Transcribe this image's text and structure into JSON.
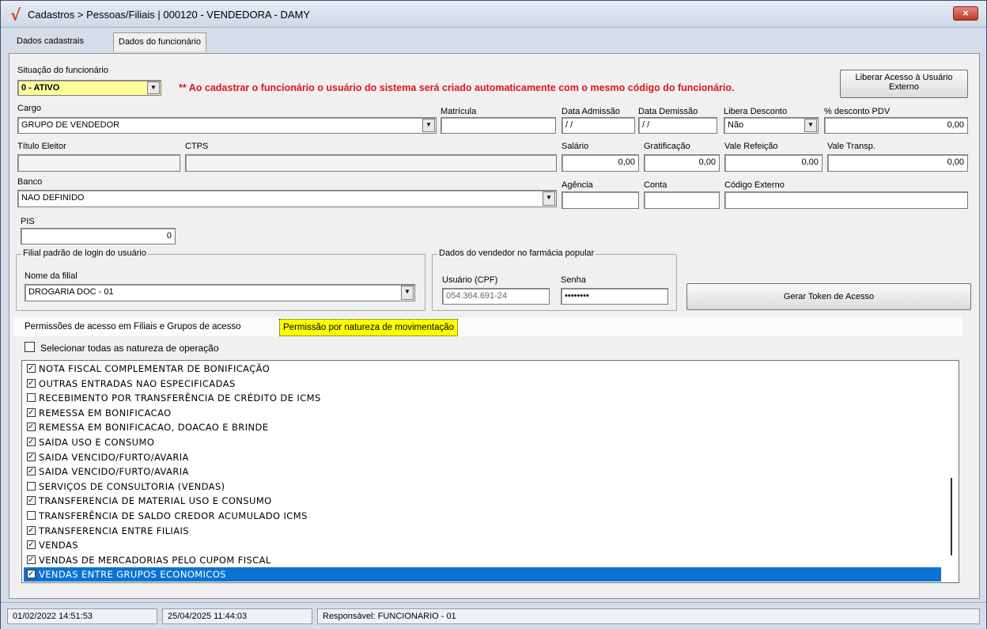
{
  "window": {
    "title": "Cadastros > Pessoas/Filiais | 000120 - VENDEDORA - DAMY",
    "logo": "√",
    "close_label": "×"
  },
  "tabs": [
    {
      "label": "Dados cadastrais"
    },
    {
      "label": "Dados do funcionário"
    }
  ],
  "form": {
    "situacao_label": "Situação do funcionário",
    "situacao_value": "0 - ATIVO",
    "warning": "** Ao cadastrar o funcionário o usuário do sistema será criado automaticamente com o mesmo código do funcionário.",
    "liberar_button": "Liberar Acesso à Usuário Externo",
    "cargo_label": "Cargo",
    "cargo_value": "GRUPO DE VENDEDOR",
    "matricula_label": "Matrícula",
    "matricula_value": "",
    "data_admissao_label": "Data Admissão",
    "data_admissao_value": " / /",
    "data_demissao_label": "Data Demissão",
    "data_demissao_value": " / /",
    "libera_desconto_label": "Libera Desconto",
    "libera_desconto_value": "Não",
    "desconto_pdv_label": "% desconto PDV",
    "desconto_pdv_value": "0,00",
    "titulo_eleitor_label": "Título Eleitor",
    "titulo_eleitor_value": "",
    "ctps_label": "CTPS",
    "ctps_value": "",
    "salario_label": "Salário",
    "salario_value": "0,00",
    "gratificacao_label": "Gratificação",
    "gratificacao_value": "0,00",
    "vale_refeicao_label": "Vale Refeição",
    "vale_refeicao_value": "0,00",
    "vale_transp_label": "Vale Transp.",
    "vale_transp_value": "0,00",
    "banco_label": "Banco",
    "banco_value": "NAO DEFINIDO",
    "agencia_label": "Agência",
    "agencia_value": "",
    "conta_label": "Conta",
    "conta_value": "",
    "codigo_externo_label": "Código Externo",
    "codigo_externo_value": "",
    "pis_label": "PIS",
    "pis_value": "0",
    "filial_group_label": "Filial padrão de login do usuário",
    "nome_filial_label": "Nome da filial",
    "nome_filial_value": "DROGARIA DOC - 01",
    "farmacia_group_label": "Dados do vendedor no farmácia popular",
    "usuario_cpf_label": "Usuário (CPF)",
    "usuario_cpf_value": "054.364.691-24",
    "senha_label": "Senha",
    "senha_value": "••••••••",
    "gerar_token_button": "Gerar Token de Acesso"
  },
  "subtabs": [
    {
      "label": "Permissões de acesso em Filiais e Grupos de acesso"
    },
    {
      "label": "Permissão por natureza de movimentação"
    }
  ],
  "select_all_label": "Selecionar todas as natureza de operação",
  "natureza_list": [
    {
      "label": "NOTA FISCAL COMPLEMENTAR DE BONIFICAÇÃO",
      "checked": true
    },
    {
      "label": "OUTRAS ENTRADAS NAO ESPECIFICADAS",
      "checked": true
    },
    {
      "label": "RECEBIMENTO POR TRANSFERÊNCIA DE CRÉDITO DE ICMS",
      "checked": false
    },
    {
      "label": "REMESSA EM BONIFICACAO",
      "checked": true
    },
    {
      "label": "REMESSA EM BONIFICACAO, DOACAO E BRINDE",
      "checked": true
    },
    {
      "label": "SAIDA USO E CONSUMO",
      "checked": true
    },
    {
      "label": "SAIDA VENCIDO/FURTO/AVARIA",
      "checked": true
    },
    {
      "label": "SAIDA VENCIDO/FURTO/AVARIA",
      "checked": true
    },
    {
      "label": "SERVIÇOS DE CONSULTORIA (VENDAS)",
      "checked": false
    },
    {
      "label": "TRANSFERENCIA DE MATERIAL USO E CONSUMO",
      "checked": true
    },
    {
      "label": "TRANSFERÊNCIA DE SALDO CREDOR ACUMULADO ICMS",
      "checked": false
    },
    {
      "label": "TRANSFERENCIA ENTRE FILIAIS",
      "checked": true
    },
    {
      "label": "VENDAS",
      "checked": true
    },
    {
      "label": "VENDAS DE MERCADORIAS PELO CUPOM FISCAL",
      "checked": true
    },
    {
      "label": "VENDAS ENTRE GRUPOS ECONOMICOS",
      "checked": true,
      "selected": true
    }
  ],
  "status": {
    "created": "01/02/2022 14:51:53",
    "modified": "25/04/2025 11:44:03",
    "responsavel": "Responsável: FUNCIONARIO - 01"
  }
}
